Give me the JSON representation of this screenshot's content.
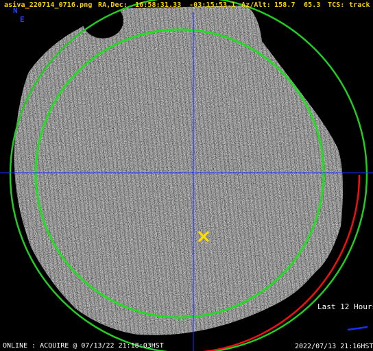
{
  "header": {
    "filename": "asiva_220714_0716.png",
    "radec_label": "RA,Dec:",
    "ra": "16:58:31.33",
    "dec": "-03:15:53.1",
    "azalt_label": "Az/Alt:",
    "az": "158.7",
    "alt": "65.3",
    "tcs_label": "TCS:",
    "tcs_status": "track"
  },
  "compass": {
    "north": "N",
    "east": "E"
  },
  "legend": {
    "trail_label": "Last 12 Hours"
  },
  "footer": {
    "status": "ONLINE : ACQUIRE @ 07/13/22 21:18:03HST",
    "timestamp": "2022/07/13 21:16HST"
  },
  "colors": {
    "header_text": "#ffd000",
    "compass": "#2a3cff",
    "inner_circle": "#22dd22",
    "outer_circle_upper": "#22cc22",
    "outer_circle_lower": "#ee1111",
    "crosshair": "#1a30ff",
    "target_marker": "#ffdd00",
    "trail": "#1a30ff"
  },
  "icons": {
    "target": "x-marker-icon"
  }
}
